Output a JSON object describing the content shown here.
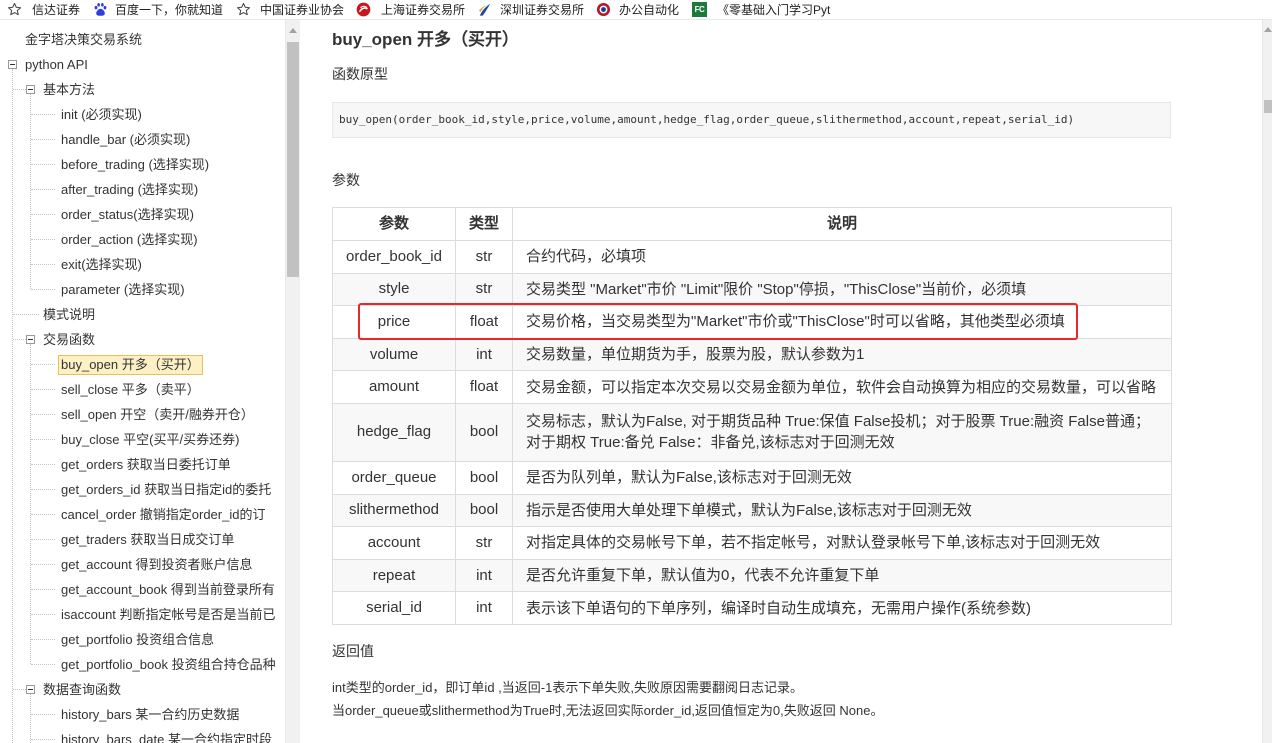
{
  "bookmarks": [
    {
      "label": "信达证券",
      "icon": "star-icon"
    },
    {
      "label": "百度一下，你就知道",
      "icon": "baidu-paw-icon"
    },
    {
      "label": "中国证券业协会",
      "icon": "star-icon"
    },
    {
      "label": "上海证券交易所",
      "icon": "sse-logo-icon"
    },
    {
      "label": "深圳证券交易所",
      "icon": "szse-logo-icon"
    },
    {
      "label": "办公自动化",
      "icon": "office-logo-icon"
    },
    {
      "label": "《零基础入门学习Pyt",
      "icon": "fishc-logo-icon",
      "icon_text": "FC"
    }
  ],
  "sidebar": {
    "top_item": "金字塔决策交易系统",
    "python_api": {
      "label": "python API",
      "basic_methods": {
        "label": "基本方法",
        "items": [
          "init (必须实现)",
          "handle_bar (必须实现)",
          "before_trading (选择实现)",
          "after_trading (选择实现)",
          "order_status(选择实现)",
          "order_action (选择实现)",
          "exit(选择实现)",
          "parameter (选择实现)"
        ]
      },
      "mode_note": "模式说明",
      "trade_functions": {
        "label": "交易函数",
        "items": [
          "buy_open 开多（买开）",
          "sell_close 平多（卖平）",
          "sell_open 开空（卖开/融券开仓）",
          "buy_close 平空(买平/买券还券)",
          "get_orders 获取当日委托订单",
          "get_orders_id 获取当日指定id的委托",
          "cancel_order 撤销指定order_id的订",
          "get_traders 获取当日成交订单",
          "get_account 得到投资者账户信息",
          "get_account_book 得到当前登录所有",
          "isaccount 判断指定帐号是否是当前已",
          "get_portfolio 投资组合信息",
          "get_portfolio_book 投资组合持仓品种"
        ]
      },
      "data_query": {
        "label": "数据查询函数",
        "items": [
          "history_bars 某一合约历史数据",
          "history_bars_date 某一合约指定时段"
        ]
      }
    }
  },
  "main": {
    "title": "buy_open 开多（买开）",
    "prototype_heading": "函数原型",
    "prototype_code": "buy_open(order_book_id,style,price,volume,amount,hedge_flag,order_queue,slithermethod,account,repeat,serial_id)",
    "params_heading": "参数",
    "table_headers": {
      "name": "参数",
      "type": "类型",
      "desc": "说明"
    },
    "params": [
      {
        "name": "order_book_id",
        "type": "str",
        "desc": "合约代码，必填项"
      },
      {
        "name": "style",
        "type": "str",
        "desc": "交易类型 \"Market\"市价 \"Limit\"限价 \"Stop\"停损，\"ThisClose\"当前价，必须填"
      },
      {
        "name": "price",
        "type": "float",
        "desc": "交易价格，当交易类型为\"Market\"市价或\"ThisClose\"时可以省略，其他类型必须填"
      },
      {
        "name": "volume",
        "type": "int",
        "desc": "交易数量，单位期货为手，股票为股，默认参数为1"
      },
      {
        "name": "amount",
        "type": "float",
        "desc": "交易金额，可以指定本次交易以交易金额为单位，软件会自动换算为相应的交易数量，可以省略"
      },
      {
        "name": "hedge_flag",
        "type": "bool",
        "desc": "交易标志，默认为False, 对于期货品种 True:保值 False投机；对于股票 True:融资 False普通；\n对于期权 True:备兑 False：非备兑,该标志对于回测无效"
      },
      {
        "name": "order_queue",
        "type": "bool",
        "desc": "是否为队列单，默认为False,该标志对于回测无效"
      },
      {
        "name": "slithermethod",
        "type": "bool",
        "desc": "指示是否使用大单处理下单模式，默认为False,该标志对于回测无效"
      },
      {
        "name": "account",
        "type": "str",
        "desc": "对指定具体的交易帐号下单，若不指定帐号，对默认登录帐号下单,该标志对于回测无效"
      },
      {
        "name": "repeat",
        "type": "int",
        "desc": "是否允许重复下单，默认值为0，代表不允许重复下单"
      },
      {
        "name": "serial_id",
        "type": "int",
        "desc": "表示该下单语句的下单序列，编译时自动生成填充，无需用户操作(系统参数)"
      }
    ],
    "return_heading": "返回值",
    "return_lines": [
      "int类型的order_id，即订单id ,当返回-1表示下单失败,失败原因需要翻阅日志记录。",
      "当order_queue或slithermethod为True时,无法返回实际order_id,返回值恒定为0,失败返回 None。"
    ]
  },
  "colors": {
    "annotation_box": "#e8262b",
    "selected_item_bg": "#fdf0c4",
    "selected_item_border": "#e6c15c",
    "table_stripe": "#f8f8f8",
    "code_bg": "#f7f7f7"
  }
}
